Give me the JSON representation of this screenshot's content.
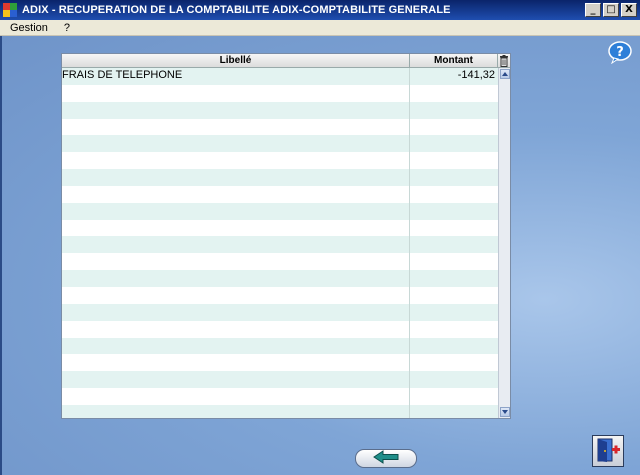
{
  "window": {
    "title": "ADIX - RECUPERATION DE LA COMPTABILITE ADIX-COMPTABILITE GENERALE",
    "controls": [
      "_",
      "□",
      "X"
    ]
  },
  "menu": {
    "items": [
      "Gestion",
      "?"
    ]
  },
  "grid": {
    "columns": [
      "Libellé",
      "Montant"
    ],
    "rows": [
      [
        "FRAIS DE TELEPHONE",
        "-141,32"
      ],
      [
        "",
        ""
      ],
      [
        "",
        ""
      ],
      [
        "",
        ""
      ],
      [
        "",
        ""
      ],
      [
        "",
        ""
      ],
      [
        "",
        ""
      ],
      [
        "",
        ""
      ],
      [
        "",
        ""
      ],
      [
        "",
        ""
      ],
      [
        "",
        ""
      ],
      [
        "",
        ""
      ],
      [
        "",
        ""
      ],
      [
        "",
        ""
      ],
      [
        "",
        ""
      ],
      [
        "",
        ""
      ],
      [
        "",
        ""
      ],
      [
        "",
        ""
      ],
      [
        "",
        ""
      ],
      [
        "",
        ""
      ],
      [
        "",
        ""
      ]
    ]
  },
  "icons": {
    "help": "help-question-icon",
    "delete": "trash-icon",
    "back": "arrow-left-icon",
    "exit": "exit-door-icon"
  },
  "colors": {
    "row_alt": "#e3f3f1",
    "background": "#7fa5d6",
    "titlebar": "#0a246a"
  }
}
